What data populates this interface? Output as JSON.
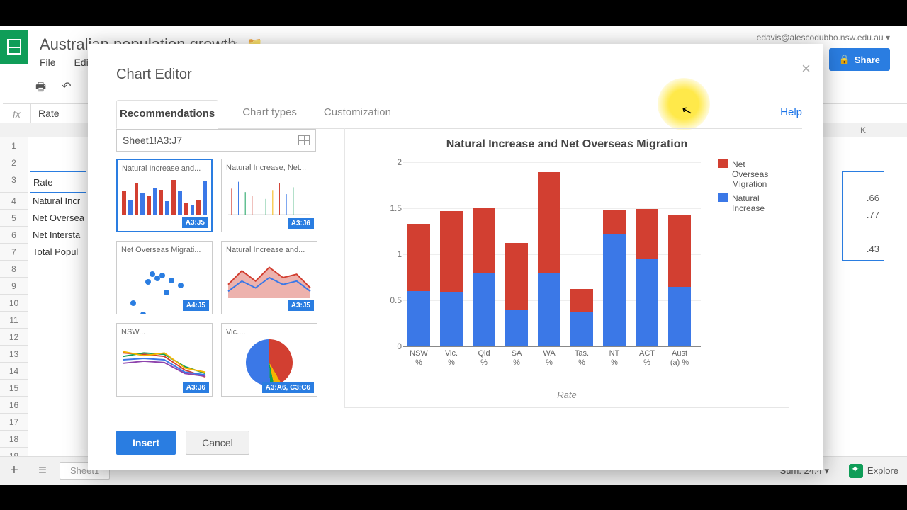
{
  "header": {
    "doc_title": "Australian population growth",
    "user_email": "edavis@alescodubbo.nsw.edu.au ▾",
    "share_label": "Share",
    "menus": [
      "File",
      "Edi"
    ]
  },
  "formula_bar": {
    "label": "fx",
    "value": "Rate"
  },
  "sheet": {
    "row3_a": "Rate",
    "row4_a": "Natural Incr",
    "row5_a": "Net Oversea",
    "row6_a": "Net Intersta",
    "row7_a": "Total Popul",
    "col_k_header": "K",
    "col_k": {
      "r4": ".66",
      "r5": ".77",
      "r7": ".43"
    }
  },
  "dialog": {
    "title": "Chart Editor",
    "tabs": {
      "rec": "Recommendations",
      "types": "Chart types",
      "custom": "Customization",
      "help": "Help"
    },
    "range": "Sheet1!A3:J7",
    "thumbs": [
      {
        "label": "Natural Increase and...",
        "badge": "A3:J5"
      },
      {
        "label": "Natural Increase, Net...",
        "badge": "A3:J6"
      },
      {
        "label": "Net Overseas Migrati...",
        "badge": "A4:J5"
      },
      {
        "label": "Natural Increase and...",
        "badge": "A3:J5"
      },
      {
        "label": "NSW...",
        "badge": "A3:J6"
      },
      {
        "label": "Vic....",
        "badge": "A3:A6, C3:C6"
      }
    ],
    "insert_label": "Insert",
    "cancel_label": "Cancel"
  },
  "chart_data": {
    "type": "bar",
    "stacked": true,
    "title": "Natural Increase and Net Overseas Migration",
    "xlabel": "Rate",
    "ylabel": "",
    "ylim": [
      0,
      2
    ],
    "yticks": [
      0,
      0.5,
      1,
      1.5,
      2
    ],
    "categories": [
      "NSW %",
      "Vic. %",
      "Qld %",
      "SA %",
      "WA %",
      "Tas. %",
      "NT %",
      "ACT %",
      "Aust (a) %"
    ],
    "series": [
      {
        "name": "Natural Increase",
        "color": "#3b78e7",
        "values": [
          0.6,
          0.59,
          0.8,
          0.4,
          0.8,
          0.38,
          1.22,
          0.95,
          0.65
        ]
      },
      {
        "name": "Net Overseas Migration",
        "color": "#d23f31",
        "values": [
          0.73,
          0.88,
          0.7,
          0.72,
          1.09,
          0.24,
          0.26,
          0.54,
          0.78
        ]
      }
    ],
    "legend_order": [
      "Net Overseas Migration",
      "Natural Increase"
    ]
  },
  "footer": {
    "sheet_tab": "Sheet1",
    "sum": "Sum: 24.4 ▾",
    "explore": "Explore"
  }
}
